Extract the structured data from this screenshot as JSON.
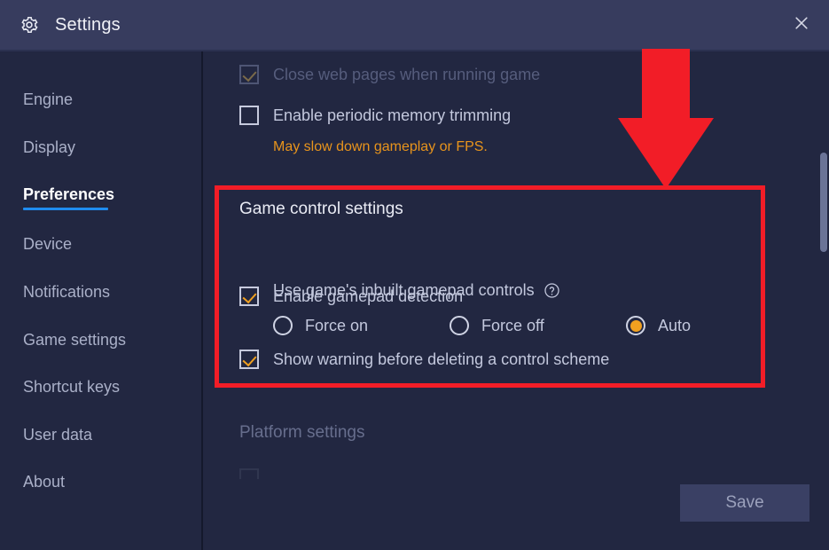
{
  "window": {
    "title": "Settings",
    "gear_icon": "gear-icon",
    "close_icon": "close-icon"
  },
  "sidebar": {
    "items": [
      {
        "label": "Engine",
        "active": false
      },
      {
        "label": "Display",
        "active": false
      },
      {
        "label": "Preferences",
        "active": true
      },
      {
        "label": "Device",
        "active": false
      },
      {
        "label": "Notifications",
        "active": false
      },
      {
        "label": "Game settings",
        "active": false
      },
      {
        "label": "Shortcut keys",
        "active": false
      },
      {
        "label": "User data",
        "active": false
      },
      {
        "label": "About",
        "active": false
      }
    ]
  },
  "content": {
    "close_web_pages": {
      "label": "Close web pages when running game",
      "checked": true,
      "dimmed": true
    },
    "memory_trimming": {
      "label": "Enable periodic memory trimming",
      "checked": false,
      "hint": "May slow down gameplay or FPS."
    },
    "game_control": {
      "section_title": "Game control settings",
      "gamepad_detection": {
        "label": "Enable gamepad detection",
        "checked": true
      },
      "inbuilt_controls": {
        "label": "Use game's inbuilt gamepad controls",
        "help_icon": "help-circle-icon",
        "options": [
          {
            "label": "Force on",
            "selected": false
          },
          {
            "label": "Force off",
            "selected": false
          },
          {
            "label": "Auto",
            "selected": true
          }
        ]
      },
      "delete_warning": {
        "label": "Show warning before deleting a control scheme",
        "checked": true
      }
    },
    "platform_settings": {
      "section_title": "Platform settings"
    },
    "save_label": "Save"
  },
  "annotation": {
    "highlight_color": "#f21d27",
    "arrow_color": "#f21d27",
    "arrow_icon": "down-arrow-icon"
  },
  "theme": {
    "window_bg": "#222741",
    "titlebar_bg": "#373c5e",
    "accent": "#1f8cf0",
    "check_color": "#f0a020",
    "warning_text": "#e8941c"
  }
}
